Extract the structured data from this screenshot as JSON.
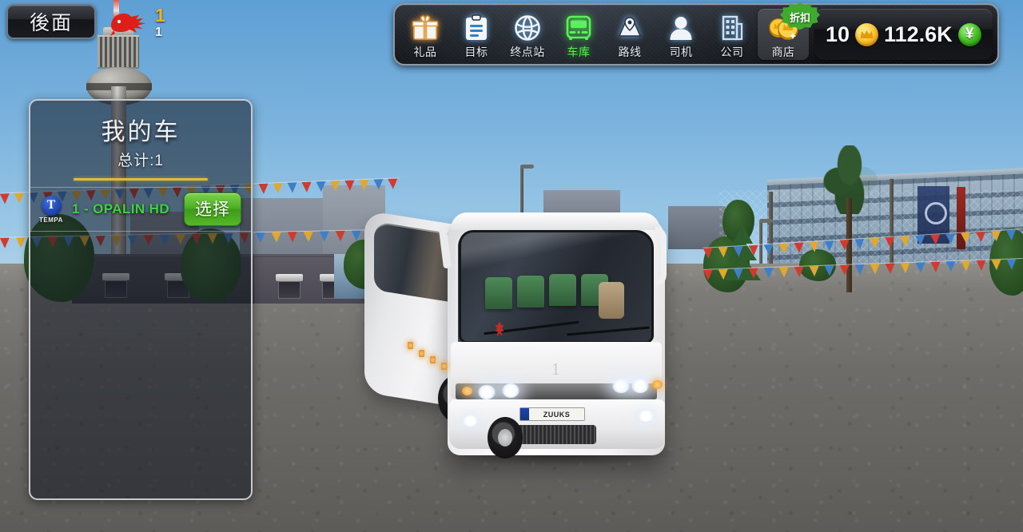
{
  "hud": {
    "back_button": "後面",
    "horse_icon": "red-horse-logo",
    "counter_gold": "1",
    "counter_white": "1"
  },
  "toolbar": {
    "items": [
      {
        "label": "礼品",
        "icon": "gift-icon",
        "glow": "orange",
        "active": false
      },
      {
        "label": "目标",
        "icon": "clipboard-icon",
        "glow": "blue",
        "active": false
      },
      {
        "label": "终点站",
        "icon": "globe-icon",
        "glow": "blue",
        "active": false
      },
      {
        "label": "车库",
        "icon": "bus-icon",
        "glow": "green",
        "active": true
      },
      {
        "label": "路线",
        "icon": "map-pin-icon",
        "glow": "blue",
        "active": false
      },
      {
        "label": "司机",
        "icon": "person-icon",
        "glow": "blue",
        "active": false
      },
      {
        "label": "公司",
        "icon": "building-icon",
        "glow": "blue",
        "active": false
      },
      {
        "label": "商店",
        "icon": "coins-icon",
        "glow": "none",
        "active": false,
        "badge": "折扣"
      }
    ]
  },
  "currency": {
    "gold_amount": "10",
    "gold_icon": "gold-coin-icon",
    "money_amount": "112.6K",
    "money_icon": "yen-coin-icon",
    "yen_symbol": "¥"
  },
  "panel": {
    "title": "我的车",
    "subtitle": "总计:1",
    "vehicles": [
      {
        "brand_mark": "T",
        "brand_name": "TEMPA",
        "name": "1 - OPALIN HD",
        "select_label": "选择"
      }
    ]
  },
  "scene": {
    "vehicle_plate_text": "ZUUKS",
    "vehicle_number": "1"
  },
  "colors": {
    "accent_green": "#4cae24",
    "vehicle_name_green": "#3fd23f",
    "active_tab_green": "#5cf05c",
    "divider_gold": "#e8b934",
    "gold_counter": "#f0b419",
    "discount_badge": "#3faa2e",
    "logo_red": "#df1f17"
  }
}
